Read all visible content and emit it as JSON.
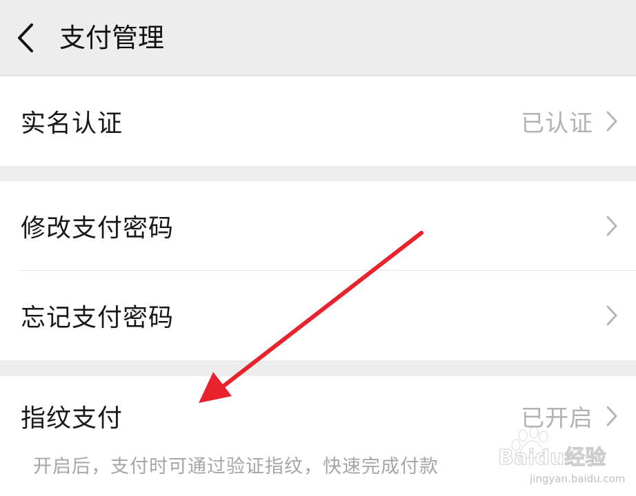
{
  "header": {
    "title": "支付管理"
  },
  "sections": {
    "identity": {
      "label": "实名认证",
      "value": "已认证"
    },
    "change_password": {
      "label": "修改支付密码"
    },
    "forgot_password": {
      "label": "忘记支付密码"
    },
    "fingerprint": {
      "label": "指纹支付",
      "value": "已开启",
      "hint": "开启后，支付时可通过验证指纹，快速完成付款"
    }
  },
  "watermark": {
    "brand": "Baidu经验",
    "url": "jingyan.baidu.com"
  },
  "colors": {
    "arrow": "#e8232d",
    "background": "#ededed",
    "secondary_text": "#b2b2b2"
  }
}
